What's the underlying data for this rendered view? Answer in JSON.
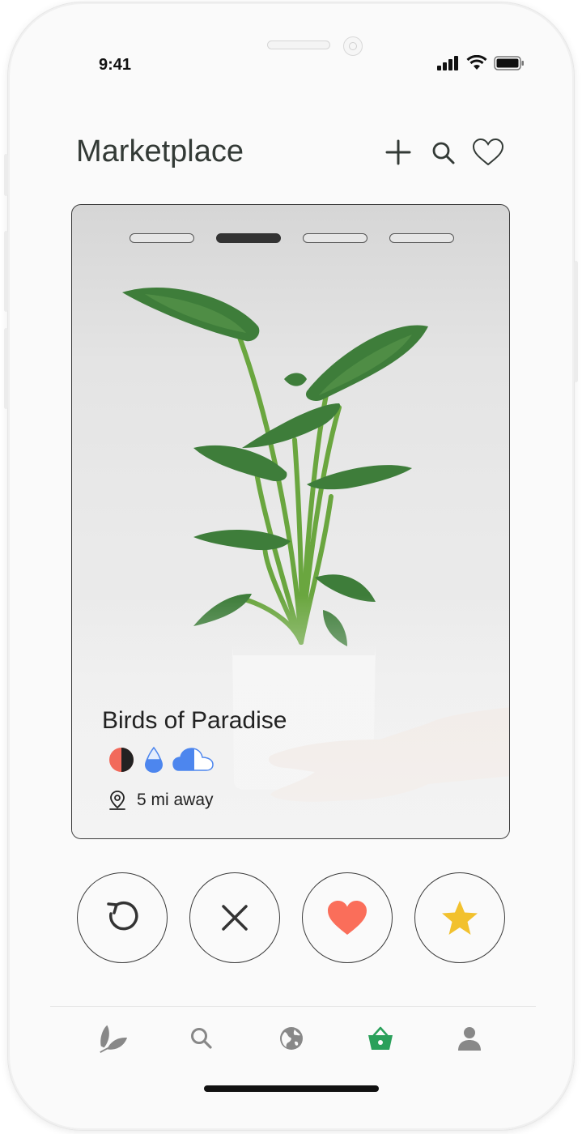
{
  "status_bar": {
    "time": "9:41"
  },
  "header": {
    "title": "Marketplace",
    "actions": [
      "plus-icon",
      "search-icon",
      "heart-outline-icon"
    ]
  },
  "card": {
    "carousel": {
      "total": 4,
      "active_index": 1
    },
    "plant_name": "Birds of Paradise",
    "care_icons": [
      "half-sun-icon",
      "water-drop-icon",
      "half-cloud-icon"
    ],
    "distance": "5 mi away"
  },
  "actions": [
    {
      "name": "undo-button",
      "icon": "undo-icon"
    },
    {
      "name": "dislike-button",
      "icon": "close-icon"
    },
    {
      "name": "like-button",
      "icon": "heart-icon",
      "color": "#fa6e5a"
    },
    {
      "name": "superlike-button",
      "icon": "star-icon",
      "color": "#f2c12e"
    }
  ],
  "bottom_nav": {
    "items": [
      "leaf-icon",
      "search-icon",
      "globe-icon",
      "basket-icon",
      "user-icon"
    ],
    "active": "basket-icon",
    "active_color": "#2aa05a",
    "inactive_color": "#888888"
  },
  "colors": {
    "sun_red": "#f26a5b",
    "water_blue": "#4d86ee",
    "text_dark": "#333a36"
  }
}
